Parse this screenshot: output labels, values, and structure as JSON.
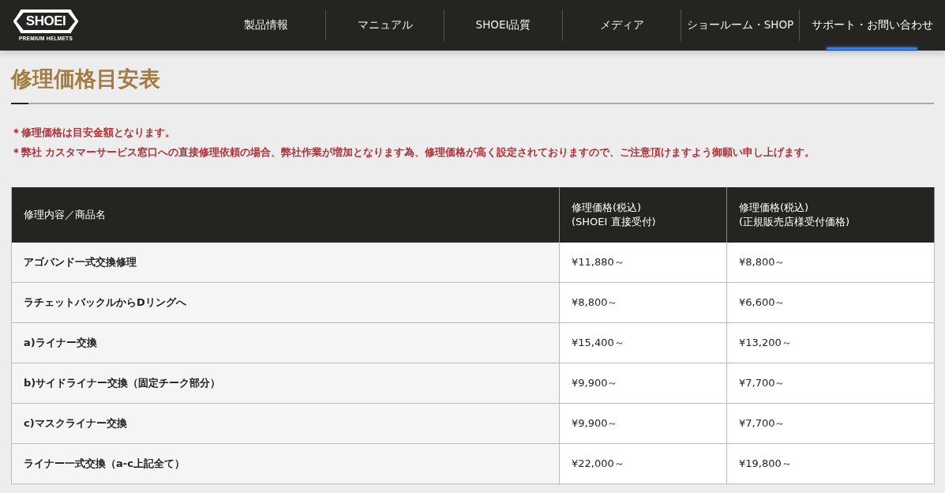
{
  "header": {
    "logo": {
      "wordmark": "SHOEI",
      "tagline": "PREMIUM HELMETS"
    },
    "nav": [
      {
        "label": "製品情報",
        "selected": false
      },
      {
        "label": "マニュアル",
        "selected": false
      },
      {
        "label": "SHOEI品質",
        "selected": false
      },
      {
        "label": "メディア",
        "selected": false
      },
      {
        "label": "ショールーム・SHOP",
        "selected": false
      },
      {
        "label": "サポート・お問い合わせ",
        "selected": true
      }
    ]
  },
  "page_title": "修理価格目安表",
  "notes": [
    "＊修理価格は目安金額となります。",
    "＊弊社 カスタマーサービス窓口への直接修理依頼の場合、弊社作業が増加となります為、修理価格が高く設定されておりますので、ご注意頂けますよう御願い申し上げます。"
  ],
  "table": {
    "columns": [
      {
        "lines": [
          "修理内容／商品名"
        ]
      },
      {
        "lines": [
          "修理価格(税込)",
          "(SHOEI 直接受付)"
        ]
      },
      {
        "lines": [
          "修理価格(税込)",
          "(正規販売店様受付価格)"
        ]
      }
    ],
    "rows": [
      [
        "アゴバンド一式交換修理",
        "¥11,880～",
        "¥8,800～"
      ],
      [
        "ラチェットバックルからDリングへ",
        "¥8,800～",
        "¥6,600～"
      ],
      [
        "a)ライナー交換",
        "¥15,400～",
        "¥13,200～"
      ],
      [
        "b)サイドライナー交換（固定チーク部分）",
        "¥9,900～",
        "¥7,700～"
      ],
      [
        "c)マスクライナー交換",
        "¥9,900～",
        "¥7,700～"
      ],
      [
        "ライナー一式交換（a-c上記全て）",
        "¥22,000～",
        "¥19,800～"
      ]
    ]
  }
}
